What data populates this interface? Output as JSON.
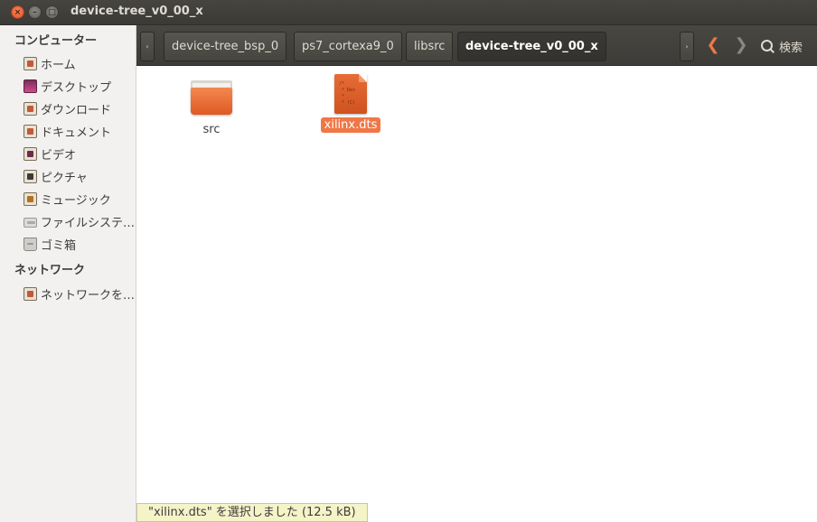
{
  "window": {
    "title": "device-tree_v0_00_x",
    "close_glyph": "×",
    "minimize_glyph": "–",
    "maximize_glyph": "□"
  },
  "sidebar": {
    "computer_header": "コンピューター",
    "items": [
      {
        "label": "ホーム",
        "icon": "home-folder-icon"
      },
      {
        "label": "デスクトップ",
        "icon": "desktop-icon"
      },
      {
        "label": "ダウンロード",
        "icon": "downloads-folder-icon"
      },
      {
        "label": "ドキュメント",
        "icon": "documents-folder-icon"
      },
      {
        "label": "ビデオ",
        "icon": "videos-folder-icon"
      },
      {
        "label": "ピクチャ",
        "icon": "pictures-folder-icon"
      },
      {
        "label": "ミュージック",
        "icon": "music-folder-icon"
      },
      {
        "label": "ファイルシステ…",
        "icon": "filesystem-drive-icon"
      },
      {
        "label": "ゴミ箱",
        "icon": "trash-icon"
      }
    ],
    "network_header": "ネットワーク",
    "network_items": [
      {
        "label": "ネットワークを…",
        "icon": "network-folder-icon"
      }
    ]
  },
  "toolbar": {
    "scroll_left_glyph": "‹",
    "scroll_right_glyph": "›",
    "breadcrumbs": [
      {
        "label": "device-tree_bsp_0"
      },
      {
        "label": "ps7_cortexa9_0"
      },
      {
        "label": "libsrc"
      },
      {
        "label": "device-tree_v0_00_x"
      }
    ],
    "back_glyph": "❮",
    "forward_glyph": "❯",
    "search_label": "検索"
  },
  "files": [
    {
      "name": "src",
      "type": "folder",
      "selected": false
    },
    {
      "name": "xilinx.dts",
      "type": "document",
      "selected": true,
      "preview_text": "/*\n * Dev\n *\n * (C)"
    }
  ],
  "status": {
    "text": "\"xilinx.dts\" を選択しました (12.5 kB)"
  }
}
